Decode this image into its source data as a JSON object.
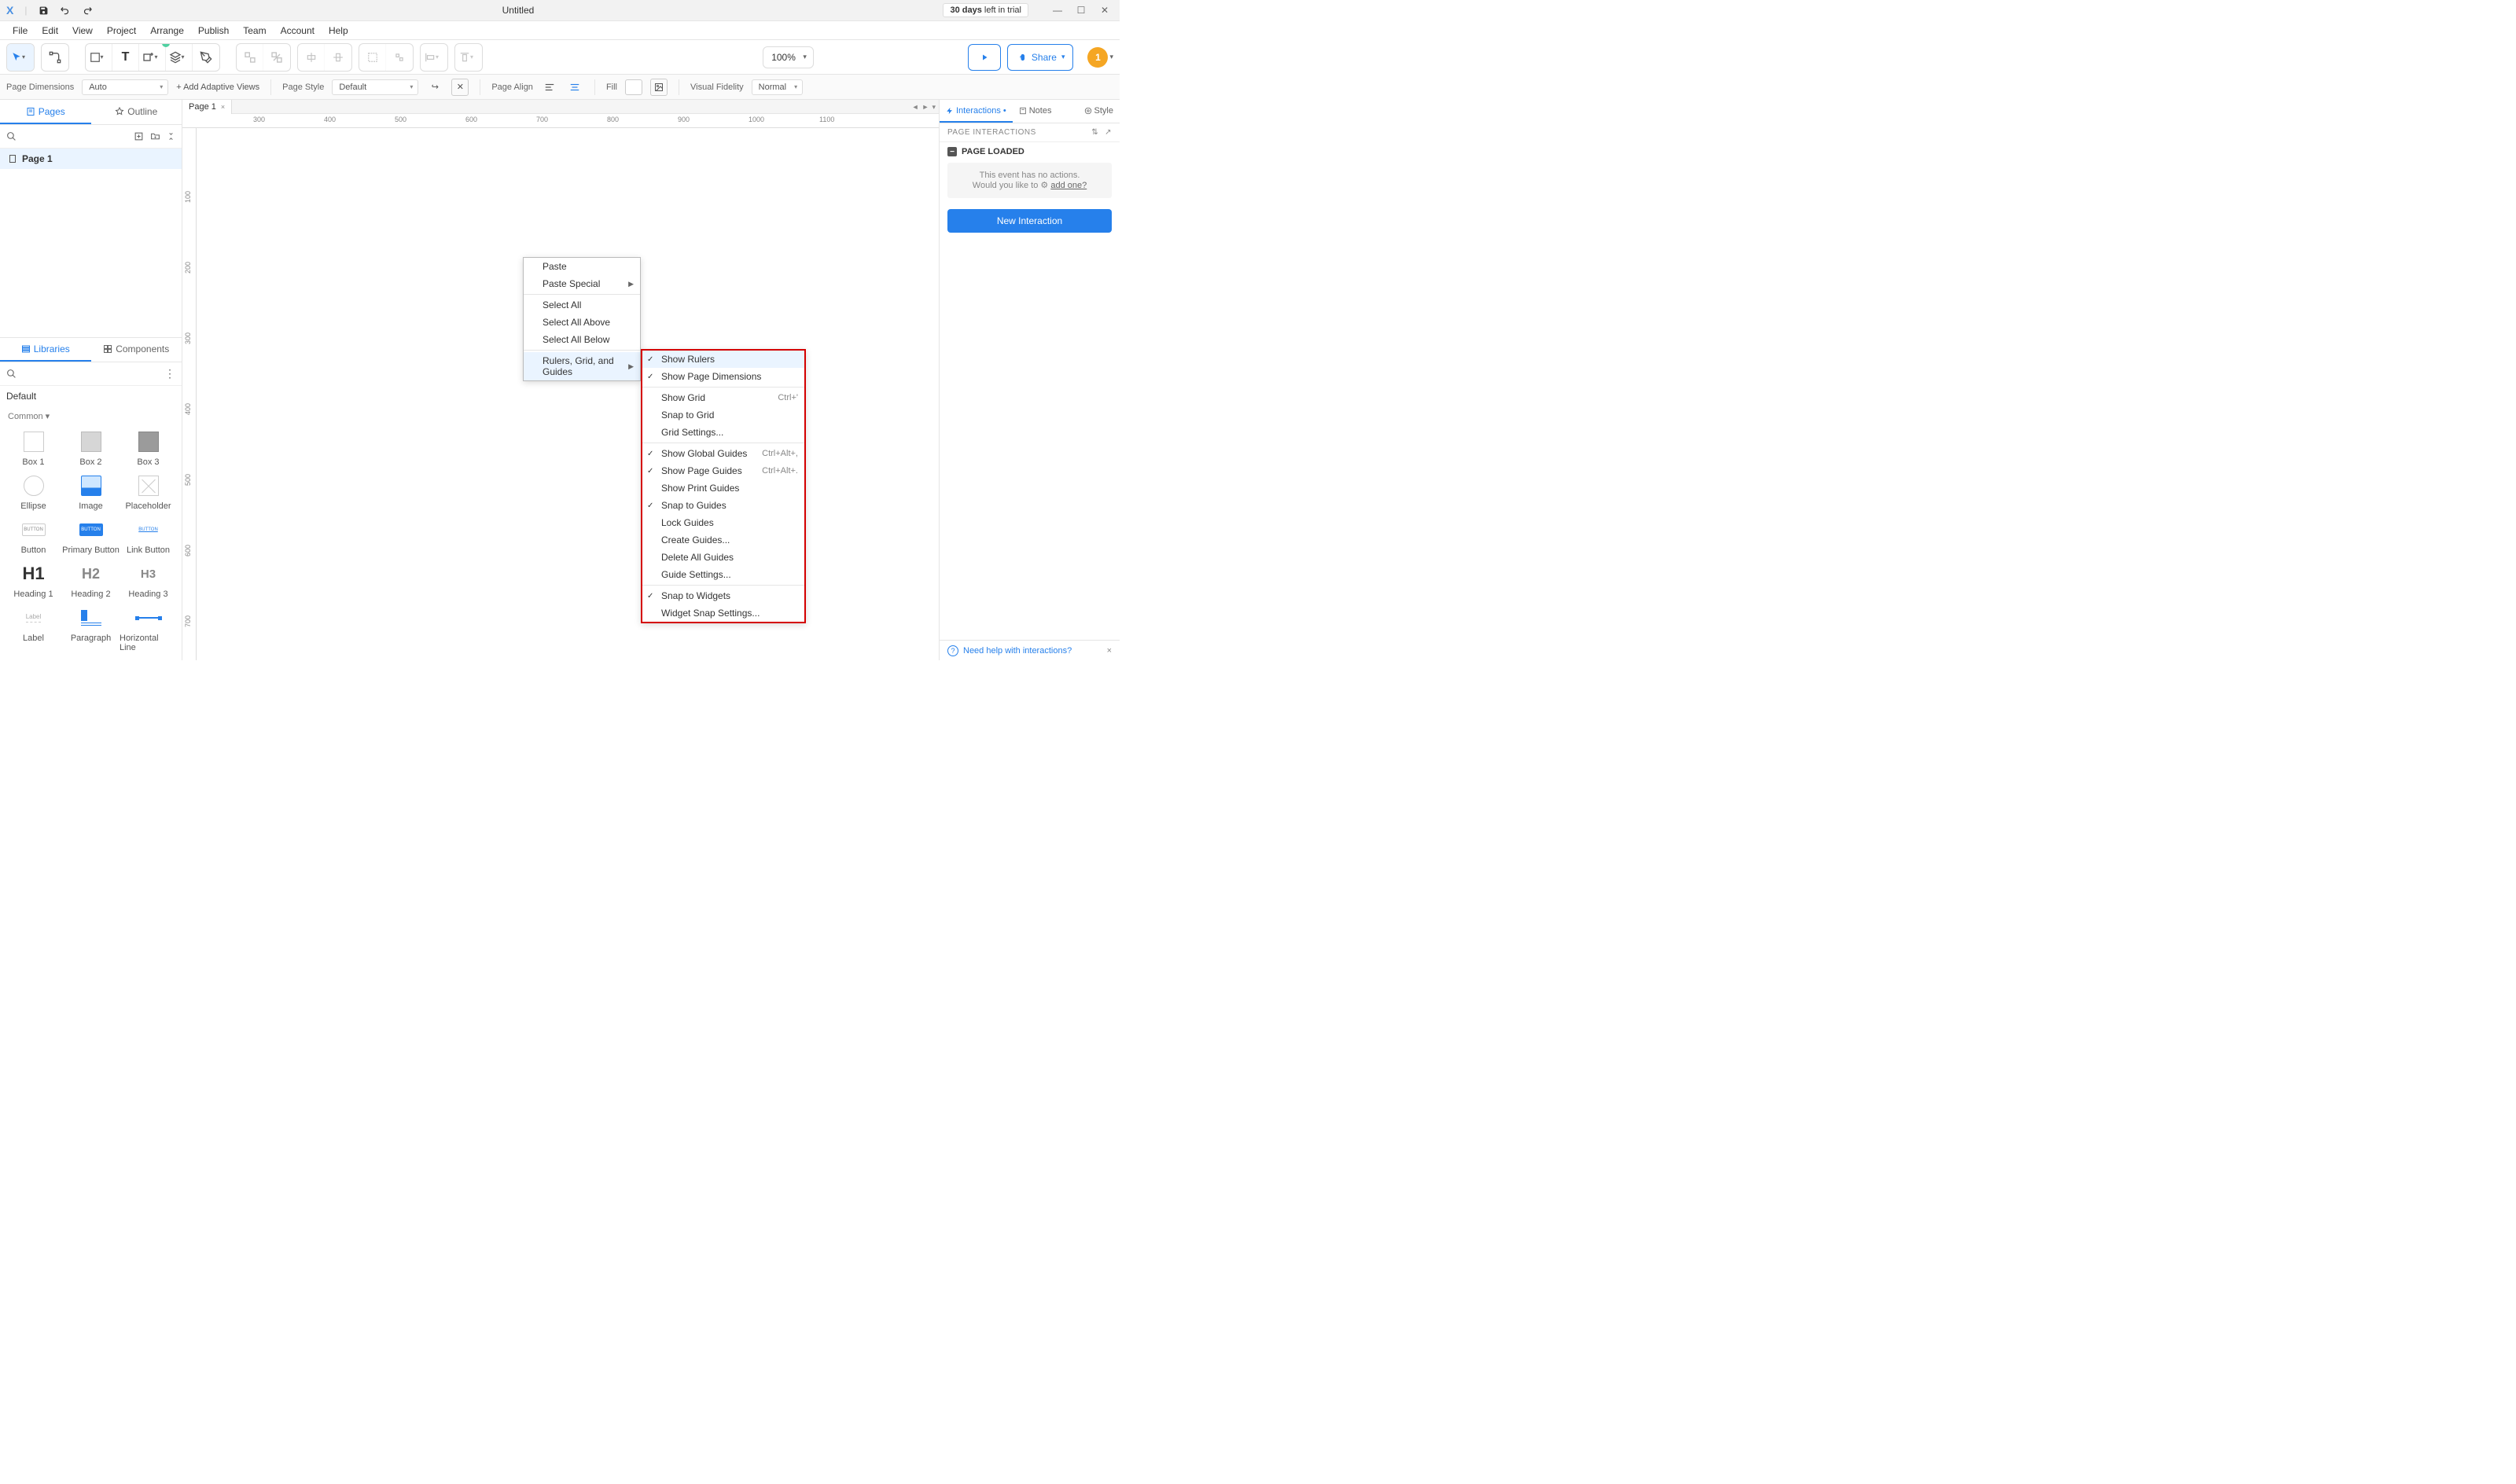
{
  "titlebar": {
    "title": "Untitled",
    "trial_days": "30 days",
    "trial_text": "left in trial"
  },
  "menubar": [
    "File",
    "Edit",
    "View",
    "Project",
    "Arrange",
    "Publish",
    "Team",
    "Account",
    "Help"
  ],
  "toolbar": {
    "zoom": "100%",
    "share": "Share",
    "avatar": "1"
  },
  "secondbar": {
    "page_dimensions_label": "Page Dimensions",
    "page_dimensions_value": "Auto",
    "add_adaptive": "+ Add Adaptive Views",
    "page_style_label": "Page Style",
    "page_style_value": "Default",
    "page_align_label": "Page Align",
    "fill_label": "Fill",
    "visual_fidelity_label": "Visual Fidelity",
    "visual_fidelity_value": "Normal"
  },
  "left": {
    "tabs": {
      "pages": "Pages",
      "outline": "Outline"
    },
    "page1": "Page 1",
    "lib_tabs": {
      "libraries": "Libraries",
      "components": "Components"
    },
    "lib_select": "Default",
    "section": "Common ▾",
    "items": [
      "Box 1",
      "Box 2",
      "Box 3",
      "Ellipse",
      "Image",
      "Placeholder",
      "Button",
      "Primary Button",
      "Link Button",
      "Heading 1",
      "Heading 2",
      "Heading 3",
      "Label",
      "Paragraph",
      "Horizontal Line"
    ]
  },
  "canvas": {
    "page_tab": "Page 1",
    "h_ticks": [
      "300",
      "400",
      "500",
      "600",
      "700",
      "800",
      "900",
      "1000",
      "1100"
    ],
    "v_ticks": [
      "100",
      "200",
      "300",
      "400",
      "500",
      "600",
      "700"
    ]
  },
  "context_menu": {
    "items": [
      {
        "label": "Paste"
      },
      {
        "label": "Paste Special",
        "arrow": true
      },
      {
        "sep": true
      },
      {
        "label": "Select All"
      },
      {
        "label": "Select All Above"
      },
      {
        "label": "Select All Below"
      },
      {
        "sep": true
      },
      {
        "label": "Rulers, Grid, and Guides",
        "arrow": true,
        "hl": true
      }
    ]
  },
  "submenu": {
    "items": [
      {
        "label": "Show Rulers",
        "check": true,
        "hl": true
      },
      {
        "label": "Show Page Dimensions",
        "check": true
      },
      {
        "sep": true
      },
      {
        "label": "Show Grid",
        "shortcut": "Ctrl+'"
      },
      {
        "label": "Snap to Grid"
      },
      {
        "label": "Grid Settings..."
      },
      {
        "sep": true
      },
      {
        "label": "Show Global Guides",
        "check": true,
        "shortcut": "Ctrl+Alt+,"
      },
      {
        "label": "Show Page Guides",
        "check": true,
        "shortcut": "Ctrl+Alt+."
      },
      {
        "label": "Show Print Guides"
      },
      {
        "label": "Snap to Guides",
        "check": true
      },
      {
        "label": "Lock Guides"
      },
      {
        "label": "Create Guides..."
      },
      {
        "label": "Delete All Guides"
      },
      {
        "label": "Guide Settings..."
      },
      {
        "sep": true
      },
      {
        "label": "Snap to Widgets",
        "check": true
      },
      {
        "label": "Widget Snap Settings..."
      }
    ]
  },
  "right": {
    "tabs": {
      "interactions": "Interactions",
      "notes": "Notes",
      "style": "Style"
    },
    "panel_header": "PAGE INTERACTIONS",
    "event": "PAGE LOADED",
    "hint_line1": "This event has no actions.",
    "hint_line2": "Would you like to ",
    "hint_link": "add one?",
    "new_interaction": "New Interaction",
    "help": "Need help with interactions?"
  }
}
